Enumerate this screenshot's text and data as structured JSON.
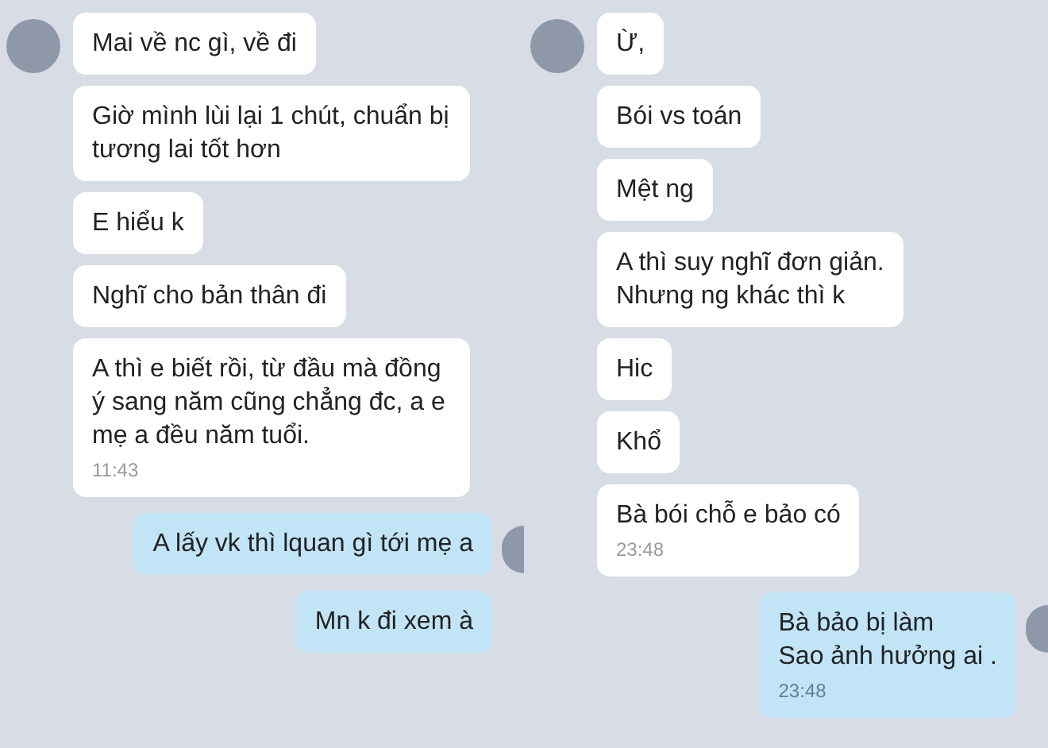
{
  "panels": [
    {
      "messages": [
        {
          "kind": "received",
          "avatar": true,
          "text": "Mai về nc gì, về đi"
        },
        {
          "kind": "received",
          "avatar": false,
          "text": "Giờ mình lùi lại 1 chút, chuẩn bị tương lai tốt hơn"
        },
        {
          "kind": "received",
          "avatar": false,
          "text": "E hiểu k"
        },
        {
          "kind": "received",
          "avatar": false,
          "text": "Nghĩ cho bản thân đi"
        },
        {
          "kind": "received",
          "avatar": false,
          "text": "A thì e biết rồi, từ đầu mà đồng ý sang năm cũng chẳng đc, a e mẹ a đều năm tuổi.",
          "time": "11:43"
        },
        {
          "kind": "sent",
          "avatar": true,
          "text": "A lấy vk thì lquan gì tới mẹ a"
        },
        {
          "kind": "sent",
          "avatar": false,
          "text": "Mn k đi xem à"
        }
      ]
    },
    {
      "messages": [
        {
          "kind": "received",
          "avatar": true,
          "text": "Ừ,"
        },
        {
          "kind": "received",
          "avatar": false,
          "text": "Bói vs toán"
        },
        {
          "kind": "received",
          "avatar": false,
          "text": "Mệt ng"
        },
        {
          "kind": "received",
          "avatar": false,
          "text": "A thì suy nghĩ đơn giản.\nNhưng ng khác thì k"
        },
        {
          "kind": "received",
          "avatar": false,
          "text": "Hic"
        },
        {
          "kind": "received",
          "avatar": false,
          "text": "Khổ"
        },
        {
          "kind": "received",
          "avatar": false,
          "text": "Bà bói chỗ e bảo có",
          "time": "23:48"
        },
        {
          "kind": "sent",
          "avatar": true,
          "text": "Bà bảo bị làm\nSao ảnh hưởng ai .",
          "time": "23:48"
        }
      ]
    }
  ]
}
